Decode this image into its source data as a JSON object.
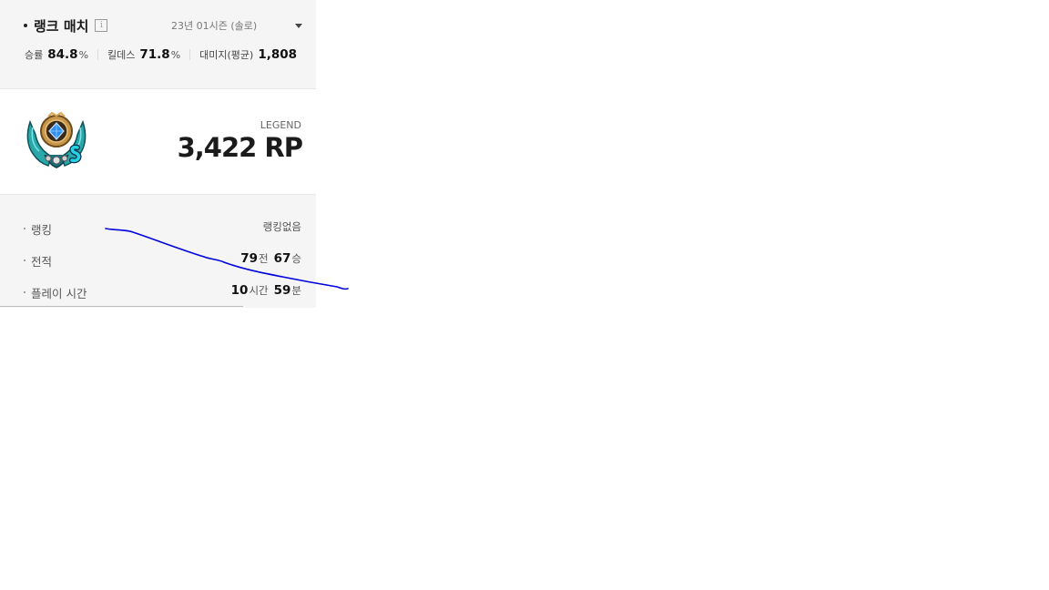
{
  "header": {
    "title": "랭크 매치",
    "info_icon": "i",
    "season": "23년 01시즌 (솔로)"
  },
  "stats": {
    "winrate_label": "승률",
    "winrate_value": "84.8",
    "winrate_unit": "%",
    "kd_label": "킬데스",
    "kd_value": "71.8",
    "kd_unit": "%",
    "damage_label": "대미지(평균)",
    "damage_value": "1,808"
  },
  "tier": {
    "name": "LEGEND",
    "rp": "3,422 RP",
    "emblem_icon": "legend-tier-emblem"
  },
  "details": {
    "ranking_label": "랭킹",
    "ranking_value": "랭킹없음",
    "record_label": "전적",
    "record_games": "79",
    "record_games_unit": "전",
    "record_wins": "67",
    "record_wins_unit": "승",
    "playtime_label": "플레이 시간",
    "playtime_hours": "10",
    "playtime_hours_unit": "시간",
    "playtime_minutes": "59",
    "playtime_minutes_unit": "분"
  },
  "colors": {
    "overlay_line": "#0000dd",
    "panel_bg": "#f5f5f5"
  }
}
